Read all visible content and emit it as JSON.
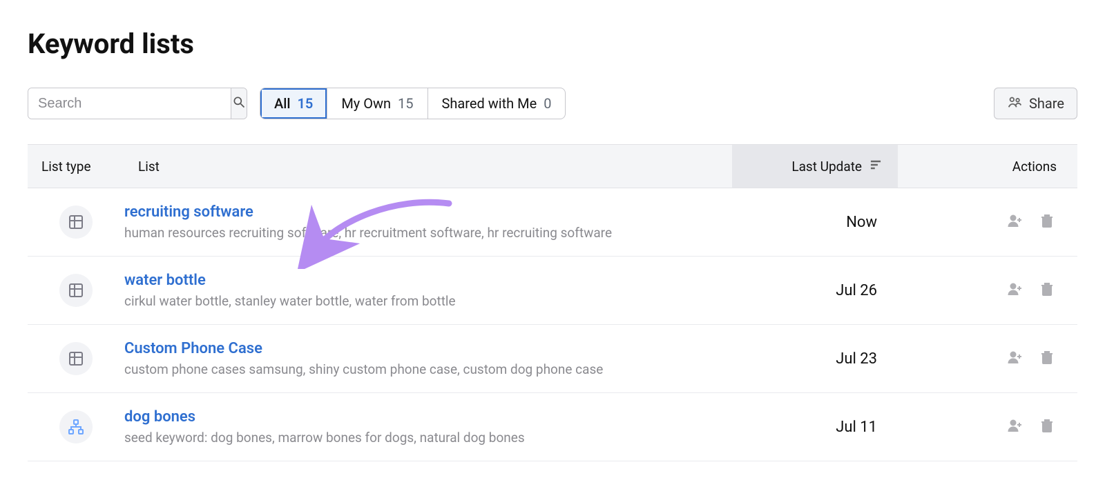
{
  "page": {
    "title": "Keyword lists"
  },
  "toolbar": {
    "search_placeholder": "Search",
    "filters": [
      {
        "label": "All",
        "count": "15",
        "active": true
      },
      {
        "label": "My Own",
        "count": "15",
        "active": false
      },
      {
        "label": "Shared with Me",
        "count": "0",
        "active": false
      }
    ],
    "share_label": "Share"
  },
  "columns": {
    "list_type": "List type",
    "list": "List",
    "last_update": "Last Update",
    "actions": "Actions"
  },
  "rows": [
    {
      "type": "table",
      "title": "recruiting software",
      "subtitle": "human resources recruiting software, hr recruitment software, hr recruiting software",
      "last_update": "Now"
    },
    {
      "type": "table",
      "title": "water bottle",
      "subtitle": "cirkul water bottle, stanley water bottle, water from bottle",
      "last_update": "Jul 26"
    },
    {
      "type": "table",
      "title": "Custom Phone Case",
      "subtitle": "custom phone cases samsung, shiny custom phone case, custom dog phone case",
      "last_update": "Jul 23"
    },
    {
      "type": "cluster",
      "title": "dog bones",
      "subtitle": "seed keyword: dog bones, marrow bones for dogs, natural dog bones",
      "last_update": "Jul 11"
    }
  ]
}
